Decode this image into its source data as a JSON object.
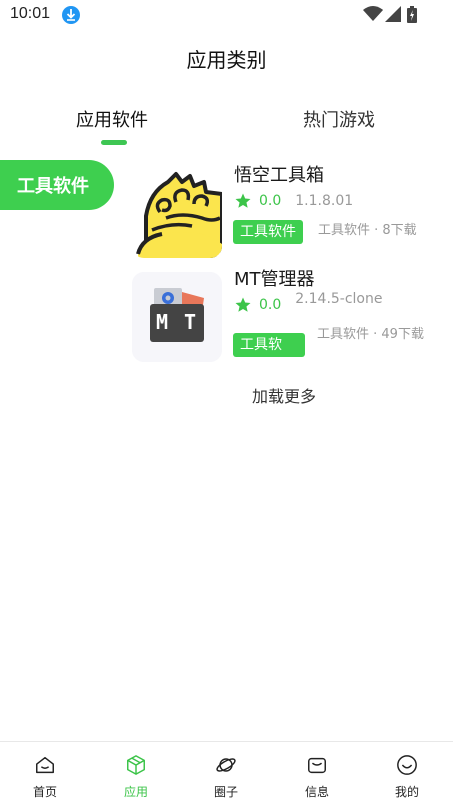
{
  "status_bar": {
    "time": "10:01"
  },
  "header": {
    "title": "应用类别"
  },
  "tabs": [
    {
      "label": "应用软件",
      "active": true
    },
    {
      "label": "热门游戏",
      "active": false
    }
  ],
  "category": {
    "label": "工具软件"
  },
  "apps": [
    {
      "name": "悟空工具箱",
      "rating": "0.0",
      "version": "1.1.8.01",
      "tag": "工具软件",
      "meta": "工具软件 · 8下载",
      "icon": "wukong-toolbox-icon"
    },
    {
      "name": "MT管理器",
      "rating": "0.0",
      "version": "2.14.5-clone",
      "tag": "工具软",
      "meta": "工具软件 · 49下载",
      "icon": "mt-manager-icon",
      "icon_text": "M T"
    }
  ],
  "load_more": "加载更多",
  "bottom_nav": [
    {
      "label": "首页",
      "icon": "home-icon",
      "active": false
    },
    {
      "label": "应用",
      "icon": "apps-cube-icon",
      "active": true
    },
    {
      "label": "圈子",
      "icon": "planet-icon",
      "active": false
    },
    {
      "label": "信息",
      "icon": "message-icon",
      "active": false
    },
    {
      "label": "我的",
      "icon": "profile-icon",
      "active": false
    }
  ],
  "colors": {
    "accent": "#3ecf4f",
    "rating": "#3cc449",
    "muted": "#999999"
  }
}
